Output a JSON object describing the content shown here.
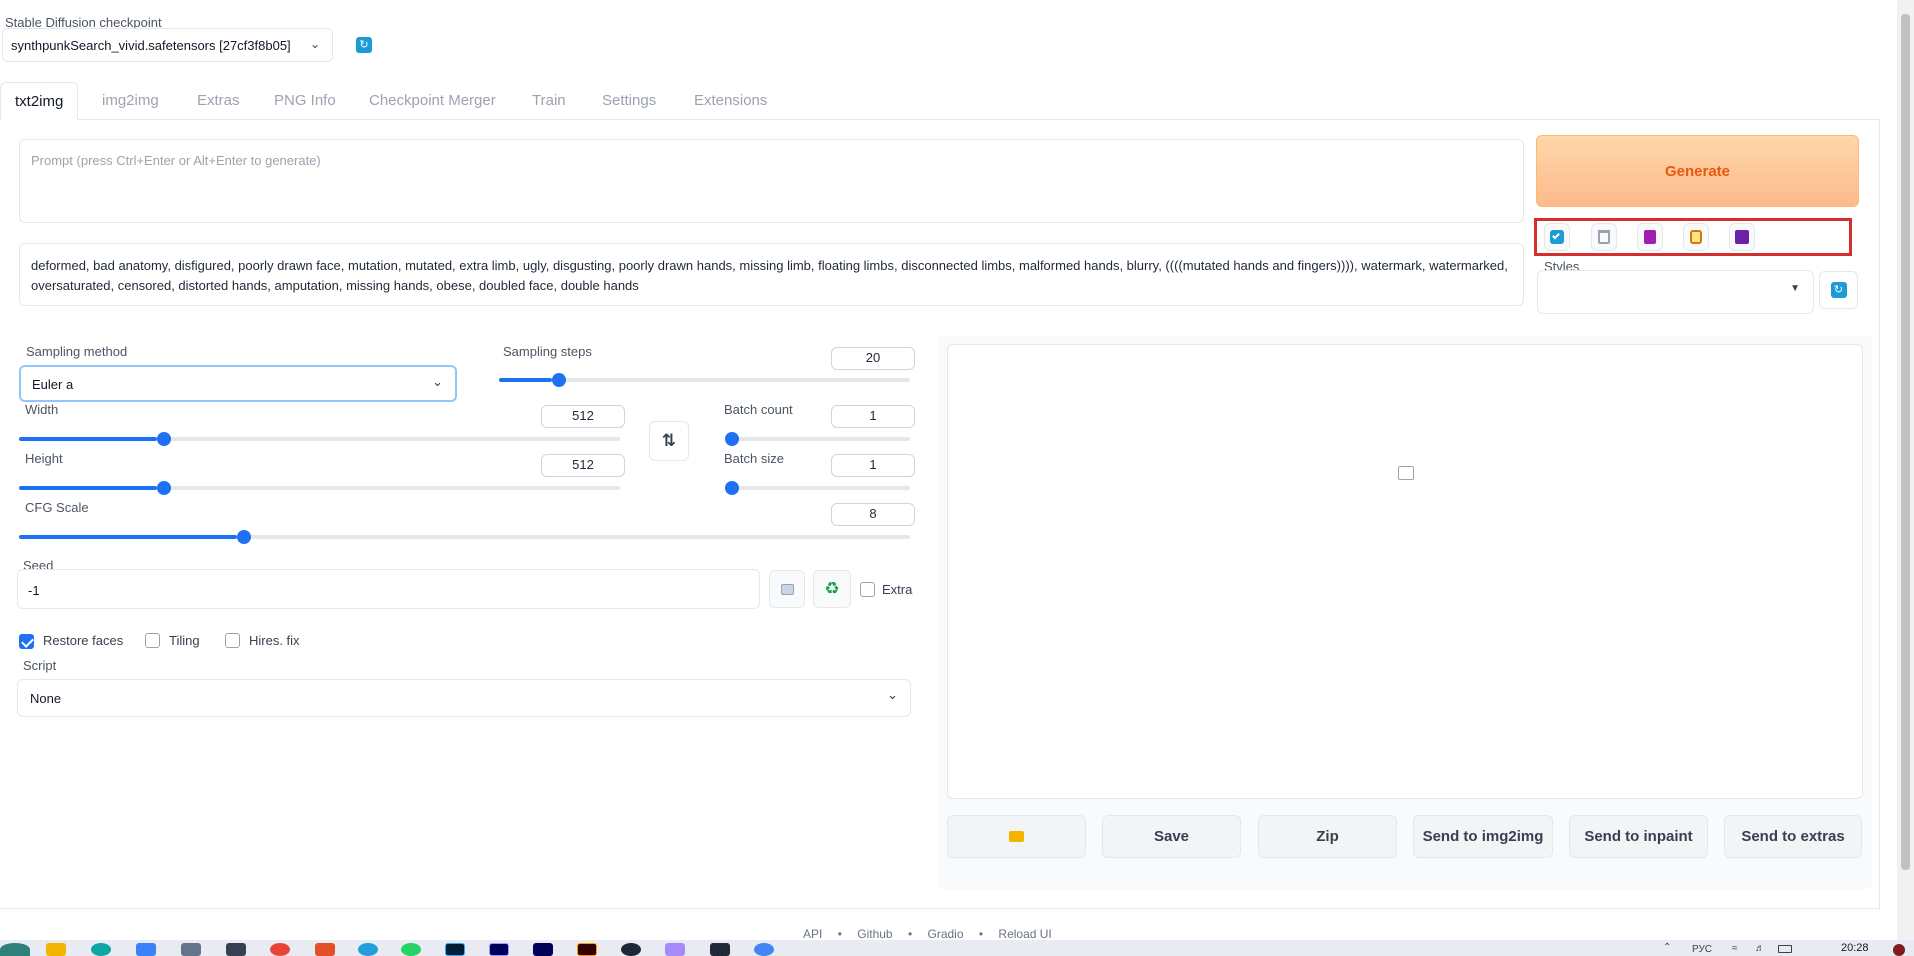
{
  "checkpoint": {
    "label": "Stable Diffusion checkpoint",
    "value": "synthpunkSearch_vivid.safetensors [27cf3f8b05]"
  },
  "tabs": [
    "txt2img",
    "img2img",
    "Extras",
    "PNG Info",
    "Checkpoint Merger",
    "Train",
    "Settings",
    "Extensions"
  ],
  "prompt": {
    "placeholder": "Prompt (press Ctrl+Enter or Alt+Enter to generate)",
    "negative_value": "deformed, bad anatomy, disfigured, poorly drawn face, mutation, mutated, extra limb, ugly, disgusting, poorly drawn hands, missing limb, floating limbs, disconnected limbs, malformed hands, blurry, ((((mutated hands and fingers)))), watermark, watermarked, oversaturated, censored, distorted hands, amputation, missing hands, obese, doubled face, double hands"
  },
  "generate_label": "Generate",
  "styles_label": "Styles",
  "tool_icons": [
    "checkbox-icon",
    "trash-icon",
    "book-icon",
    "clipboard-icon",
    "save-disk-icon"
  ],
  "sampling": {
    "method_label": "Sampling method",
    "method_value": "Euler a",
    "steps_label": "Sampling steps",
    "steps_value": "20",
    "steps_fraction": 0.13
  },
  "width": {
    "label": "Width",
    "value": "512",
    "fraction": 0.23
  },
  "height": {
    "label": "Height",
    "value": "512",
    "fraction": 0.23
  },
  "batch_count": {
    "label": "Batch count",
    "value": "1",
    "fraction": 0.0
  },
  "batch_size": {
    "label": "Batch size",
    "value": "1",
    "fraction": 0.0
  },
  "cfg": {
    "label": "CFG Scale",
    "value": "8",
    "fraction": 0.245
  },
  "seed": {
    "label": "Seed",
    "value": "-1",
    "extra_label": "Extra"
  },
  "checkboxes": {
    "restore_faces": "Restore faces",
    "tiling": "Tiling",
    "hires_fix": "Hires. fix"
  },
  "script": {
    "label": "Script",
    "value": "None"
  },
  "output_buttons": {
    "save": "Save",
    "zip": "Zip",
    "send_img2img": "Send to img2img",
    "send_inpaint": "Send to inpaint",
    "send_extras": "Send to extras"
  },
  "footer": [
    "API",
    "Github",
    "Gradio",
    "Reload UI"
  ],
  "clock": "20:28",
  "language": "РУС",
  "colors": {
    "accent": "#1d72f3",
    "generate_bg": "#fdba8c",
    "generate_text": "#ea580c",
    "highlight_border": "#d32f2f"
  }
}
